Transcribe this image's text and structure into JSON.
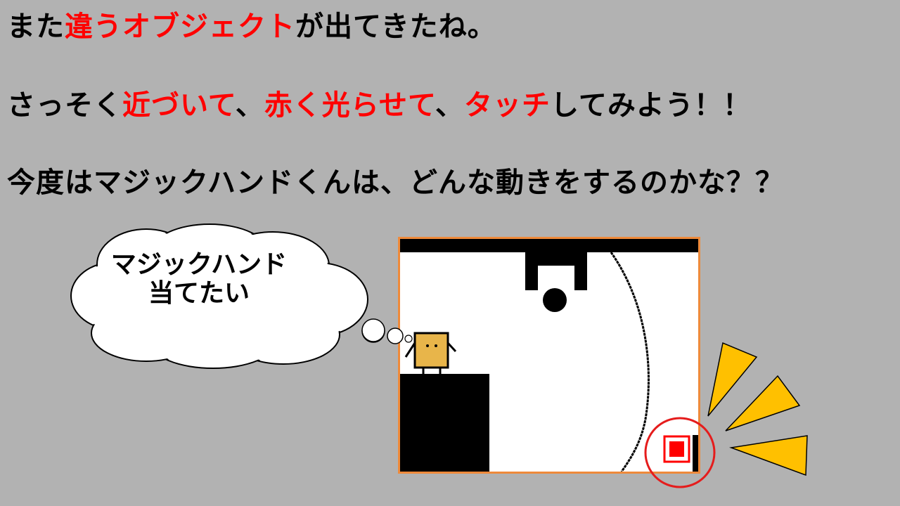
{
  "instructions": {
    "line1": {
      "pre": "また",
      "highlight": "違うオブジェクト",
      "post": "が出てきたね。"
    },
    "line2": {
      "p1": "さっそく",
      "h1": "近づいて",
      "p2": "、",
      "h2": "赤く光らせて",
      "p3": "、",
      "h3": "タッチ",
      "p4": "してみよう！！"
    },
    "line3": {
      "text": "今度はマジックハンドくんは、どんな動きをするのかな？？"
    }
  },
  "thought_bubble": {
    "line1": "マジックハンド",
    "line2": "当てたい"
  },
  "colors": {
    "background": "#b2b2b2",
    "highlight_text": "#ff0000",
    "game_border": "#ee8a3b",
    "character_body": "#e8b54a",
    "target_box": "#ff0000",
    "highlight_circle": "#e51c1c",
    "burst_rays": "#ffc000"
  },
  "icons": {
    "character": "box-character-icon",
    "target": "red-square-target-icon",
    "emphasis": "burst-rays-icon"
  }
}
